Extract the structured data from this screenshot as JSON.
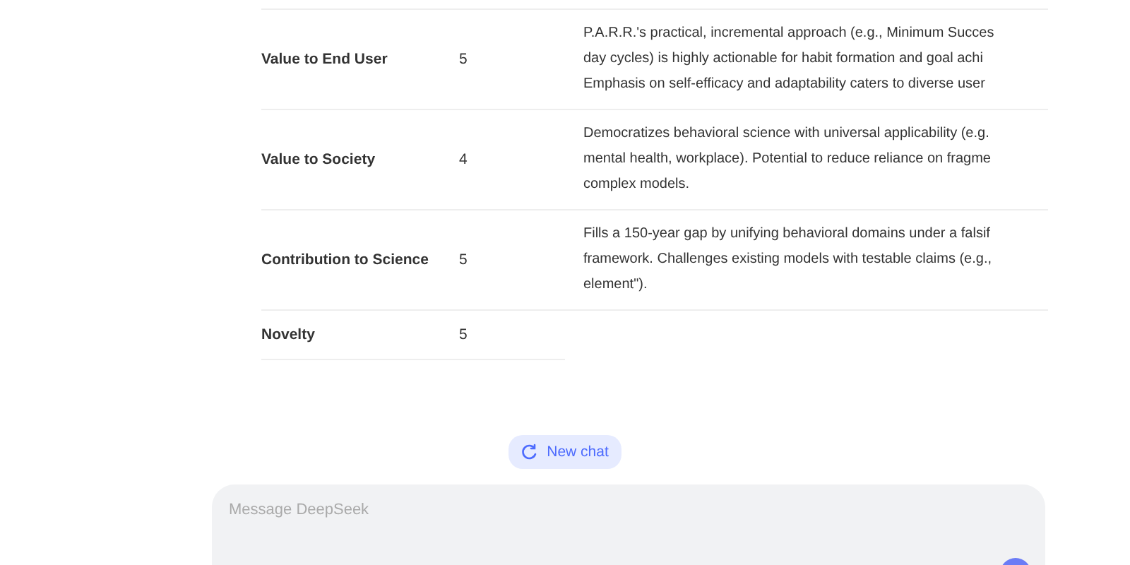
{
  "table": {
    "rows": [
      {
        "criterion": "Value to End User",
        "score": "5",
        "description": [
          "P.A.R.R.'s practical, incremental approach (e.g., Minimum Succes",
          "day cycles) is highly actionable for habit formation and goal achi",
          "Emphasis on self-efficacy and adaptability caters to diverse user"
        ]
      },
      {
        "criterion": "Value to Society",
        "score": "4",
        "description": [
          "Democratizes behavioral science with universal applicability (e.g.",
          "mental health, workplace). Potential to reduce reliance on fragme",
          "complex models."
        ]
      },
      {
        "criterion": "Contribution to Science",
        "score": "5",
        "description": [
          "Fills a 150-year gap by unifying behavioral domains under a falsif",
          "framework. Challenges existing models with testable claims (e.g.,",
          "element\")."
        ]
      },
      {
        "criterion": "Novelty",
        "score": "5",
        "description": []
      }
    ]
  },
  "new_chat_button": {
    "label": "New chat"
  },
  "composer": {
    "placeholder": "Message DeepSeek"
  }
}
